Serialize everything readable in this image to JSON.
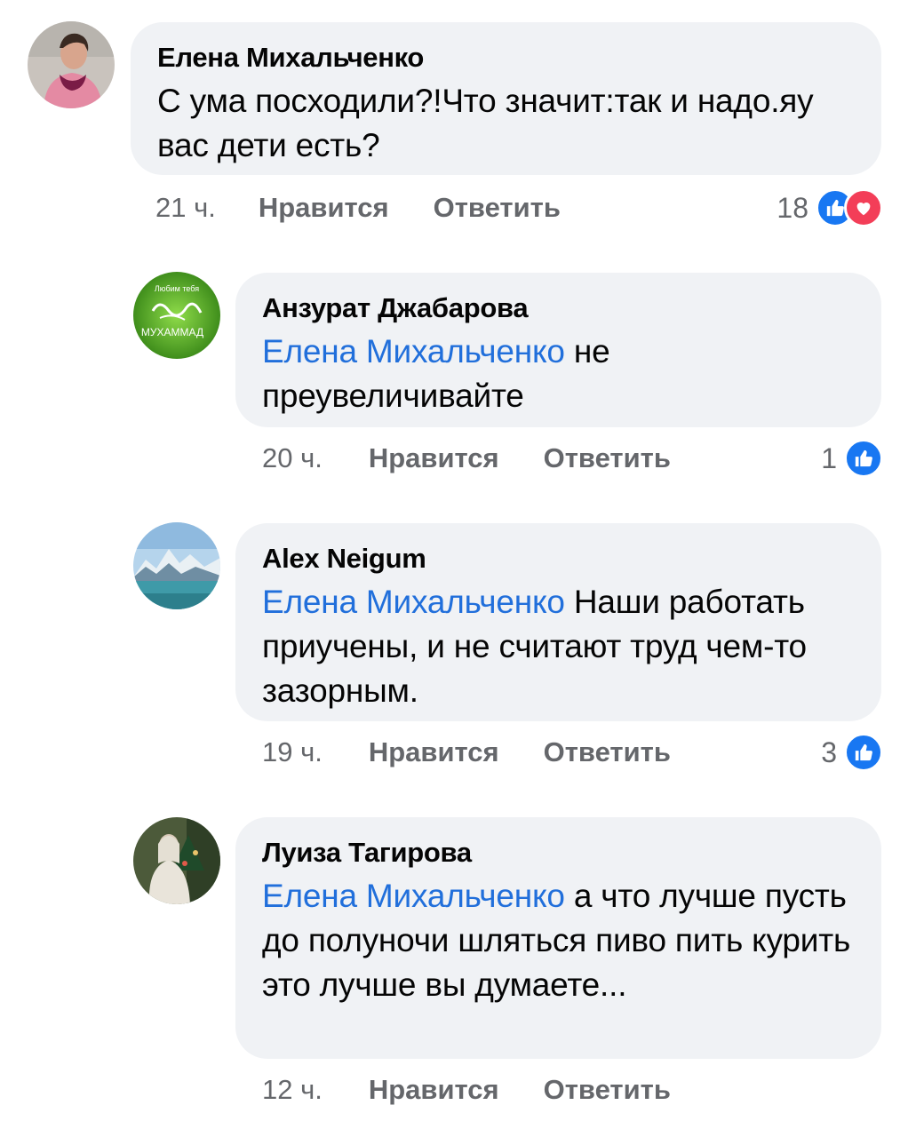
{
  "comments": [
    {
      "author": "Елена Михальченко",
      "mention": "",
      "text": "С ума посходили?!Что значит:так и надо.яу вас дети есть?",
      "time": "21 ч.",
      "like_label": "Нравится",
      "reply_label": "Ответить",
      "reaction_count": "18",
      "reactions": [
        "like-icon",
        "love-icon"
      ]
    },
    {
      "author": "Анзурат Джабарова",
      "mention": "Елена Михальченко",
      "text": "не преувеличивайте",
      "time": "20 ч.",
      "like_label": "Нравится",
      "reply_label": "Ответить",
      "reaction_count": "1",
      "reactions": [
        "like-icon"
      ]
    },
    {
      "author": "Alex Neigum",
      "mention": "Елена Михальченко",
      "text": "Наши работать приучены, и не считают труд чем-то зазорным.",
      "time": "19 ч.",
      "like_label": "Нравится",
      "reply_label": "Ответить",
      "reaction_count": "3",
      "reactions": [
        "like-icon"
      ]
    },
    {
      "author": "Луиза Тагирова",
      "mention": "Елена Михальченко",
      "text": "а что лучше пусть до полуночи шляться пиво пить курить это лучше вы думаете...",
      "time": "12 ч.",
      "like_label": "Нравится",
      "reply_label": "Ответить",
      "reaction_count": "",
      "reactions": []
    }
  ],
  "avatar_text": {
    "c1_line1": "Любим тебя",
    "c1_line2": "МУХАММАД"
  },
  "colors": {
    "bubble": "#f0f2f5",
    "mention": "#216fdb",
    "meta": "#65676b",
    "like": "#1877f2",
    "love": "#f33e58"
  }
}
